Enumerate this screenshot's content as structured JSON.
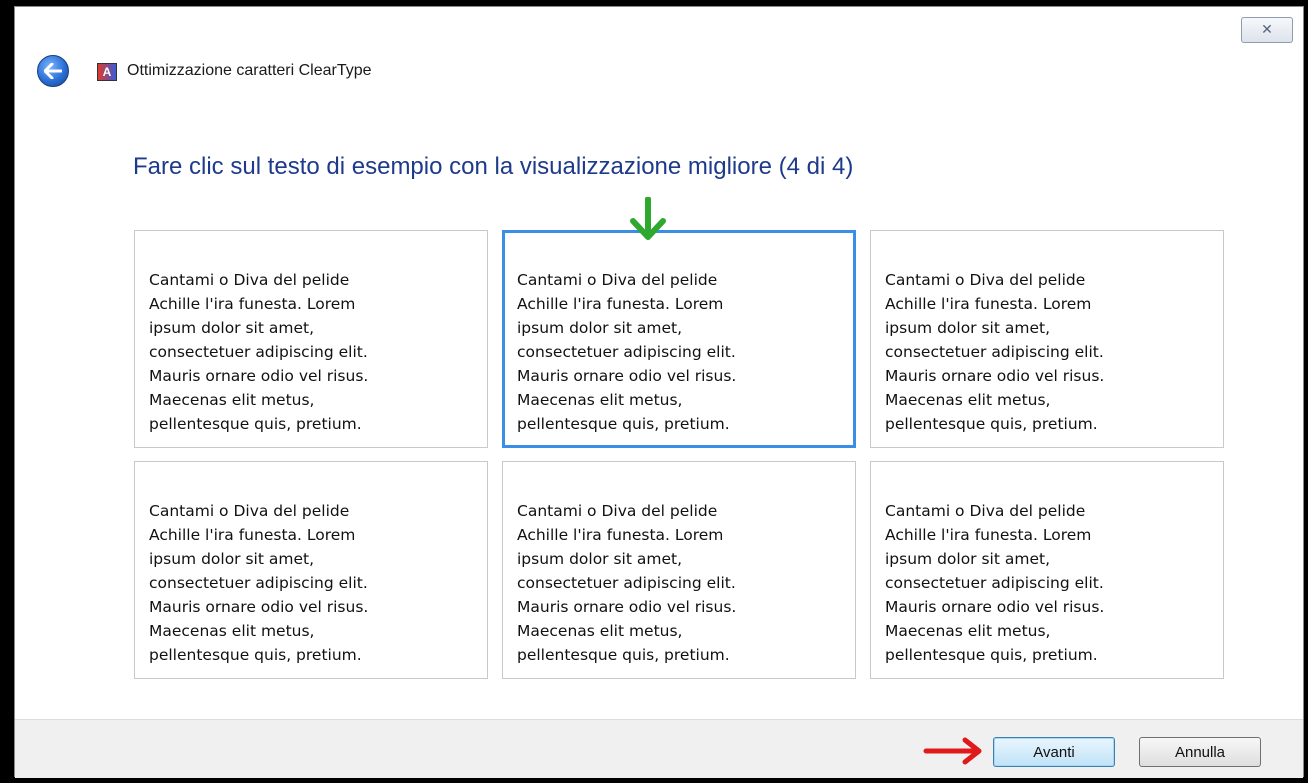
{
  "window": {
    "title": "Ottimizzazione caratteri ClearType",
    "app_icon_letter": "A",
    "close_label": "✕"
  },
  "instruction": "Fare clic sul testo di esempio con la visualizzazione migliore (4 di 4)",
  "samples": [
    {
      "text": "Cantami o Diva del pelide\nAchille l'ira funesta. Lorem\nipsum dolor sit amet,\nconsectetuer adipiscing elit.\nMauris ornare odio vel risus.\nMaecenas elit metus,\npellentesque quis, pretium.",
      "selected": false
    },
    {
      "text": "Cantami o Diva del pelide\nAchille l'ira funesta. Lorem\nipsum dolor sit amet,\nconsectetuer adipiscing elit.\nMauris ornare odio vel risus.\nMaecenas elit metus,\npellentesque quis, pretium.",
      "selected": true
    },
    {
      "text": "Cantami o Diva del pelide\nAchille l'ira funesta. Lorem\nipsum dolor sit amet,\nconsectetuer adipiscing elit.\nMauris ornare odio vel risus.\nMaecenas elit metus,\npellentesque quis, pretium.",
      "selected": false
    },
    {
      "text": "Cantami o Diva del pelide\nAchille l'ira funesta. Lorem\nipsum dolor sit amet,\nconsectetuer adipiscing elit.\nMauris ornare odio vel risus.\nMaecenas elit metus,\npellentesque quis, pretium.",
      "selected": false
    },
    {
      "text": "Cantami o Diva del pelide\nAchille l'ira funesta. Lorem\nipsum dolor sit amet,\nconsectetuer adipiscing elit.\nMauris ornare odio vel risus.\nMaecenas elit metus,\npellentesque quis, pretium.",
      "selected": false
    },
    {
      "text": "Cantami o Diva del pelide\nAchille l'ira funesta. Lorem\nipsum dolor sit amet,\nconsectetuer adipiscing elit.\nMauris ornare odio vel risus.\nMaecenas elit metus,\npellentesque quis, pretium.",
      "selected": false
    }
  ],
  "buttons": {
    "next_label": "Avanti",
    "cancel_label": "Annulla"
  },
  "colors": {
    "selected_border": "#3b8ee8",
    "instruction_text": "#1e3a8a",
    "annotation_green": "#2fa82f",
    "annotation_red": "#e01a1a"
  },
  "icons": {
    "back": "back-arrow-icon",
    "app": "cleartype-app-icon",
    "close": "close-icon",
    "green_annotation": "down-arrow-icon",
    "red_annotation": "right-arrow-icon"
  }
}
